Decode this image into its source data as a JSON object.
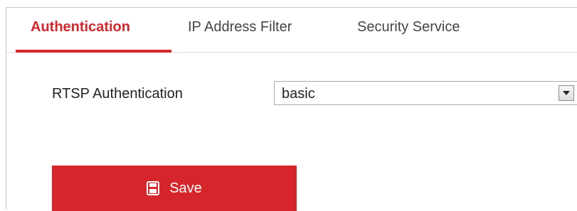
{
  "tabs": [
    {
      "label": "Authentication",
      "active": true
    },
    {
      "label": "IP Address Filter",
      "active": false
    },
    {
      "label": "Security Service",
      "active": false
    }
  ],
  "form": {
    "rtsp_label": "RTSP Authentication",
    "rtsp_value": "basic"
  },
  "actions": {
    "save_label": "Save",
    "save_icon": "floppy-disk-icon"
  },
  "colors": {
    "accent": "#d6262b",
    "tab_text": "#444444",
    "border": "#c9c9c9"
  }
}
